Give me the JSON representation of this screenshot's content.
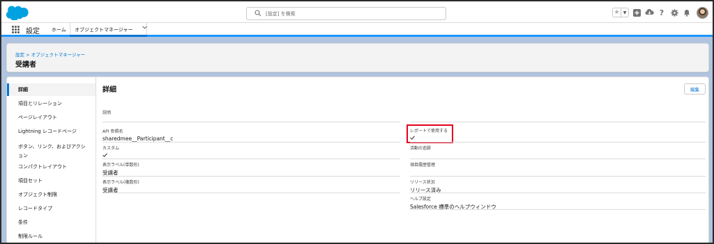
{
  "header": {
    "search_placeholder": "[設定] を検索"
  },
  "app_nav": {
    "app_name": "設定",
    "home_label": "ホーム",
    "tab_label": "オブジェクトマネージャー"
  },
  "page_header": {
    "breadcrumb": "設定 > オブジェクトマネージャー",
    "title": "受講者"
  },
  "sidebar": {
    "items": [
      {
        "label": "詳細"
      },
      {
        "label": "項目とリレーション"
      },
      {
        "label": "ページレイアウト"
      },
      {
        "label": "Lightning レコードページ"
      },
      {
        "label": "ボタン、リンク、およびアクシ"
      },
      {
        "label": "ョン"
      },
      {
        "label": "コンパクトレイアウト"
      },
      {
        "label": "項目セット"
      },
      {
        "label": "オブジェクト制限"
      },
      {
        "label": "レコードタイプ"
      },
      {
        "label": "条件"
      },
      {
        "label": "制限ルール"
      }
    ]
  },
  "detail": {
    "section_title": "詳細",
    "edit_label": "編集",
    "left": {
      "description_label": "説明",
      "description_value": "",
      "api_name_label": "API 参照名",
      "api_name_value": "sharedmee__Participant__c",
      "custom_label": "カスタム",
      "singular_label": "表示ラベル(単数形)",
      "singular_value": "受講者",
      "plural_label": "表示ラベル(複数形)",
      "plural_value": "受講者"
    },
    "right": {
      "reports_label": "レポートで使用する",
      "activities_label": "活動の追跡",
      "history_label": "項目履歴管理",
      "deployment_label": "リリース状況",
      "deployment_value": "リリース済み",
      "help_label": "ヘルプ設定",
      "help_value": "Salesforce 標準のヘルプウィンドウ"
    }
  },
  "colors": {
    "brand_blue": "#0176d3",
    "highlight_red": "#e3001b",
    "logo_blue": "#00a1e0"
  }
}
